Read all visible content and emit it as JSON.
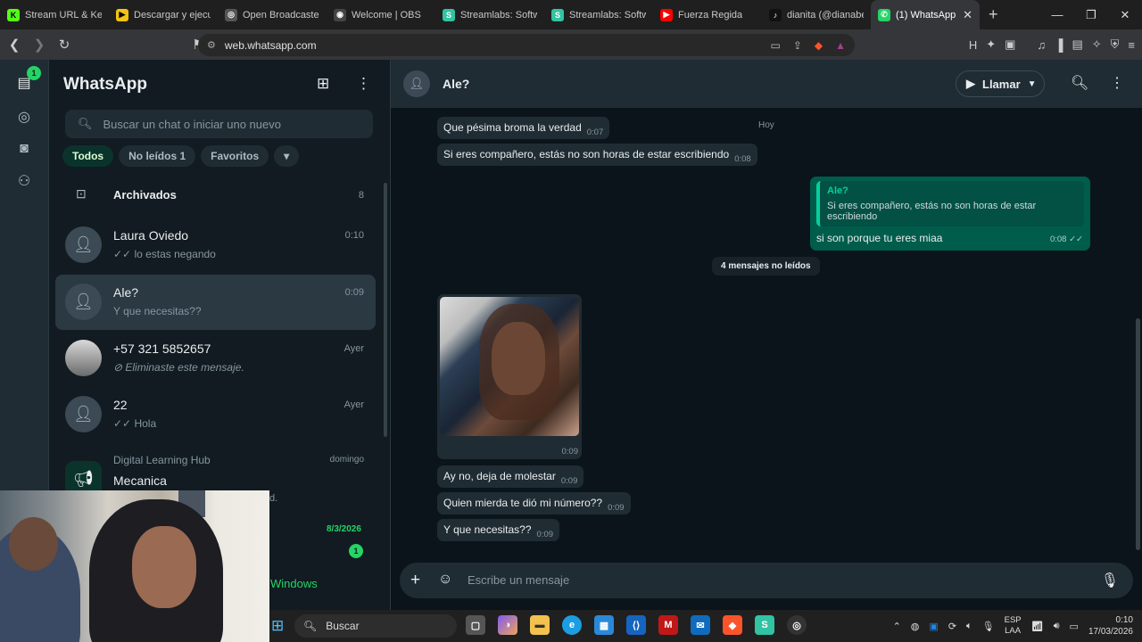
{
  "browser": {
    "tabs": [
      {
        "title": "Stream URL & Key",
        "fav": "K",
        "color": "#53fc18"
      },
      {
        "title": "Descargar y ejecut",
        "fav": "▶",
        "color": "#f1c40f"
      },
      {
        "title": "Open Broadcaster",
        "fav": "◎",
        "color": "#555555"
      },
      {
        "title": "Welcome | OBS",
        "fav": "◉",
        "color": "#444444"
      },
      {
        "title": "Streamlabs: Softw",
        "fav": "S",
        "color": "#31c3a2"
      },
      {
        "title": "Streamlabs: Softw",
        "fav": "S",
        "color": "#31c3a2"
      },
      {
        "title": "Fuerza Regida",
        "fav": "▶",
        "color": "#ff0000"
      },
      {
        "title": "dianita (@dianabe",
        "fav": "♪",
        "color": "#111111"
      },
      {
        "title": "(1) WhatsApp",
        "fav": "✆",
        "color": "#25d366",
        "active": true
      }
    ],
    "url": "web.whatsapp.com"
  },
  "rail": {
    "chats_badge": "1"
  },
  "sidebar": {
    "title": "WhatsApp",
    "search_placeholder": "Buscar un chat o iniciar uno nuevo",
    "chips": [
      "Todos",
      "No leídos 1",
      "Favoritos"
    ],
    "archived": {
      "label": "Archivados",
      "count": "8"
    },
    "chats": [
      {
        "name": "Laura Oviedo",
        "time": "0:10",
        "last": "✓✓ lo estas negando"
      },
      {
        "name": "Ale?",
        "time": "0:09",
        "last": "Y que necesitas??"
      },
      {
        "name": "+57 321 5852657",
        "time": "Ayer",
        "last": "⊘ Eliminaste este mensaje."
      },
      {
        "name": "22",
        "time": "Ayer",
        "last": "✓✓ Hola"
      }
    ],
    "community": {
      "group": "Digital Learning Hub",
      "name": "Mecanica",
      "time": "domingo",
      "last_fragment": "d."
    },
    "next_date": "8/3/2026",
    "next_badge": "1"
  },
  "chat": {
    "name": "Ale?",
    "call_label": "Llamar",
    "date_marker": "Hoy",
    "unread_marker": "4 mensajes no leídos",
    "incoming_top": [
      {
        "text": "Que pésima broma la verdad",
        "time": "0:07"
      },
      {
        "text": "Si eres compañero, estás no son horas de estar escribiendo",
        "time": "0:08"
      }
    ],
    "outgoing": {
      "quote_name": "Ale?",
      "quote_text": "Si eres compañero, estás no son horas de estar escribiendo",
      "text": "si son porque tu eres miaa",
      "time": "0:08 ✓✓"
    },
    "image_time": "0:09",
    "incoming_bottom": [
      {
        "text": "Ay no, deja de molestar",
        "time": "0:09"
      },
      {
        "text": "Quien mierda te dió mi número??",
        "time": "0:09"
      },
      {
        "text": "Y que necesitas??",
        "time": "0:09"
      }
    ],
    "composer_placeholder": "Escribe un mensaje"
  },
  "overlay": {
    "activate_windows": "Windows"
  },
  "taskbar": {
    "search": "Buscar",
    "lang_top": "ESP",
    "lang_bottom": "LAA",
    "time": "0:10",
    "date": "17/03/2026"
  },
  "colors": {
    "accent": "#25d366",
    "outgoing_bubble": "#005c4b",
    "incoming_bubble": "#202c33",
    "background": "#0b141a"
  }
}
